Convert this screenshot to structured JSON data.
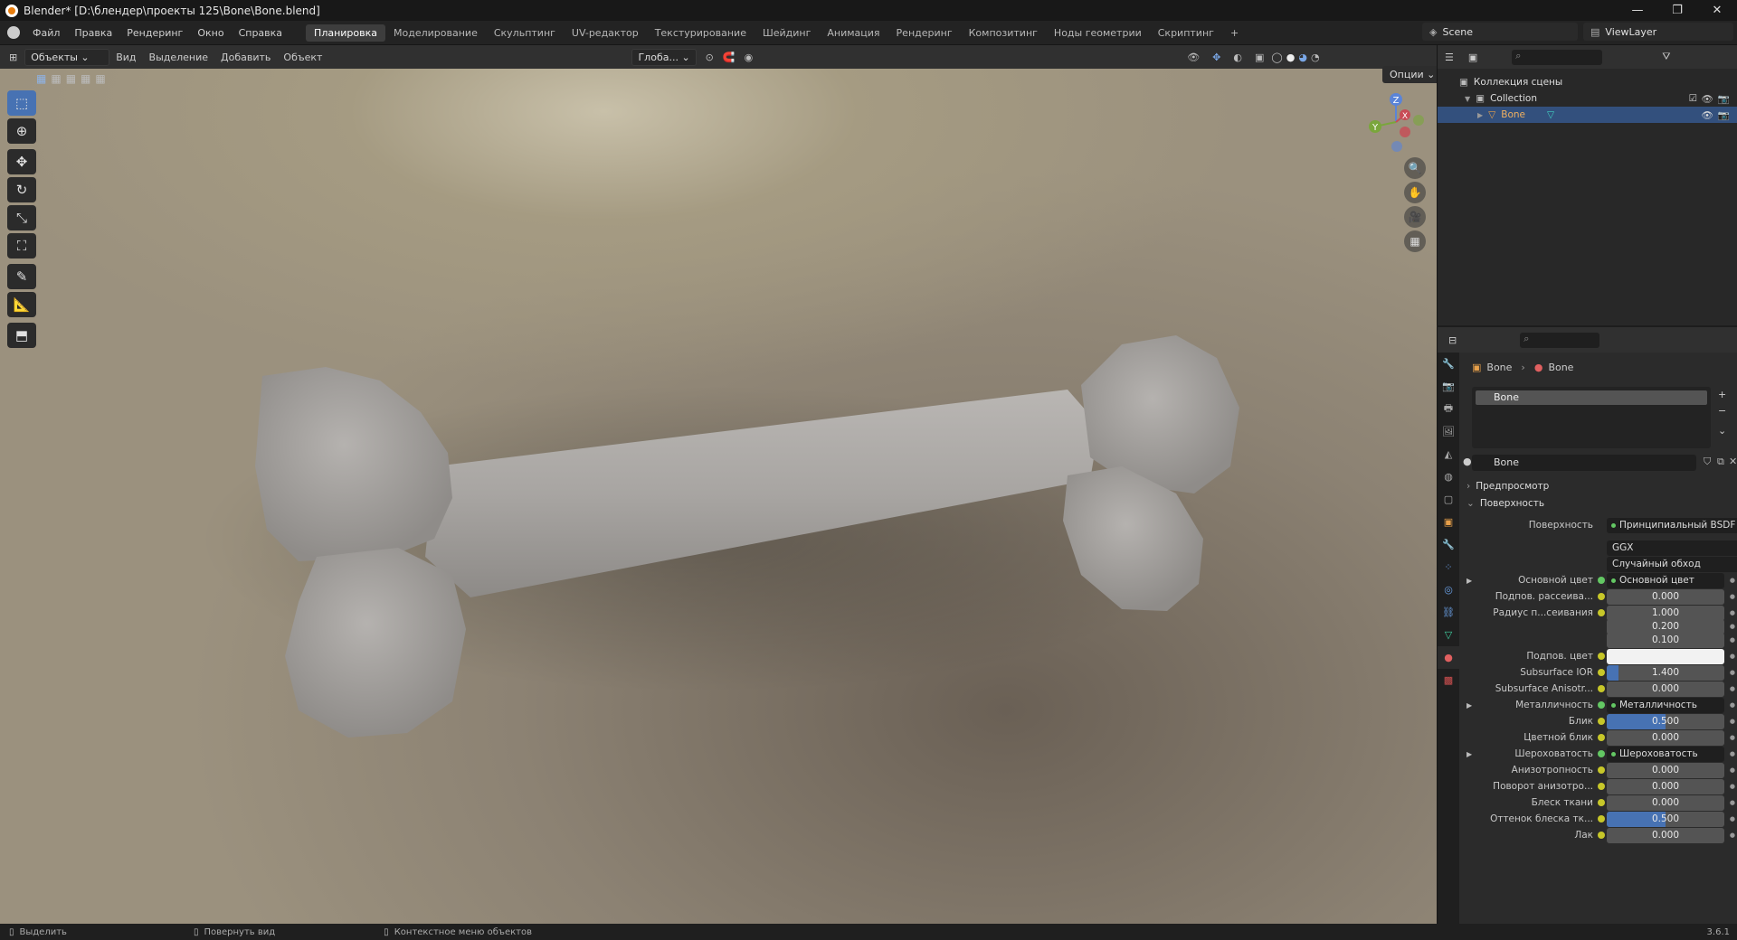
{
  "window": {
    "title": "Blender* [D:\\блендер\\проекты 125\\Bone\\Bone.blend]",
    "ctrl_min": "—",
    "ctrl_max": "❐",
    "ctrl_close": "✕"
  },
  "menu": {
    "items": [
      "Файл",
      "Правка",
      "Рендеринг",
      "Окно",
      "Справка"
    ],
    "workspaces": [
      "Планировка",
      "Моделирование",
      "Скульптинг",
      "UV-редактор",
      "Текстурирование",
      "Шейдинг",
      "Анимация",
      "Рендеринг",
      "Композитинг",
      "Ноды геометрии",
      "Скриптинг",
      "+"
    ],
    "active_workspace": 0
  },
  "scene": {
    "name": "Scene",
    "viewlayer": "ViewLayer"
  },
  "viewport_header": {
    "mode": "Объекты",
    "menus": [
      "Вид",
      "Выделение",
      "Добавить",
      "Объект"
    ],
    "transform": "Глоба...",
    "options": "Опции"
  },
  "gizmo": {
    "z": "Z",
    "y": "Y",
    "x": "X"
  },
  "outliner": {
    "scene_collection": "Коллекция сцены",
    "collection": "Collection",
    "object": "Bone"
  },
  "properties": {
    "breadcrumb_object": "Bone",
    "breadcrumb_material": "Bone",
    "slot": "Bone",
    "material_name": "Bone",
    "sections": {
      "preview": "Предпросмотр",
      "surface": "Поверхность"
    },
    "surface_label": "Поверхность",
    "surface_value": "Принципиальный BSDF",
    "distribution": "GGX",
    "subsurface_method": "Случайный обход",
    "rows": [
      {
        "label": "Основной цвет",
        "kind": "link",
        "value": "Основной цвет",
        "expand": true
      },
      {
        "label": "Подпов. рассеива...",
        "kind": "num",
        "value": "0.000",
        "fill": 0
      },
      {
        "label": "Радиус п...сеивания",
        "kind": "num",
        "value": "1.000",
        "fill": 0
      },
      {
        "label": "",
        "kind": "num",
        "value": "0.200",
        "fill": 0
      },
      {
        "label": "",
        "kind": "num",
        "value": "0.100",
        "fill": 0
      },
      {
        "label": "Подпов. цвет",
        "kind": "color",
        "value": "",
        "fill": 0
      },
      {
        "label": "Subsurface IOR",
        "kind": "num",
        "value": "1.400",
        "fill": 0.1
      },
      {
        "label": "Subsurface Anisotr...",
        "kind": "num",
        "value": "0.000",
        "fill": 0
      },
      {
        "label": "Металличность",
        "kind": "link",
        "value": "Металличность",
        "expand": true
      },
      {
        "label": "Блик",
        "kind": "num",
        "value": "0.500",
        "fill": 0.5
      },
      {
        "label": "Цветной блик",
        "kind": "num",
        "value": "0.000",
        "fill": 0
      },
      {
        "label": "Шероховатость",
        "kind": "link",
        "value": "Шероховатость",
        "expand": true
      },
      {
        "label": "Анизотропность",
        "kind": "num",
        "value": "0.000",
        "fill": 0
      },
      {
        "label": "Поворот анизотро...",
        "kind": "num",
        "value": "0.000",
        "fill": 0
      },
      {
        "label": "Блеск ткани",
        "kind": "num",
        "value": "0.000",
        "fill": 0
      },
      {
        "label": "Оттенок блеска тк...",
        "kind": "num",
        "value": "0.500",
        "fill": 0.5
      },
      {
        "label": "Лак",
        "kind": "num",
        "value": "0.000",
        "fill": 0
      }
    ]
  },
  "status": {
    "select": "Выделить",
    "rotate": "Повернуть вид",
    "context": "Контекстное меню объектов",
    "version": "3.6.1"
  },
  "colors": {
    "accent": "#4772b3",
    "bone": "#a9a6a3"
  }
}
